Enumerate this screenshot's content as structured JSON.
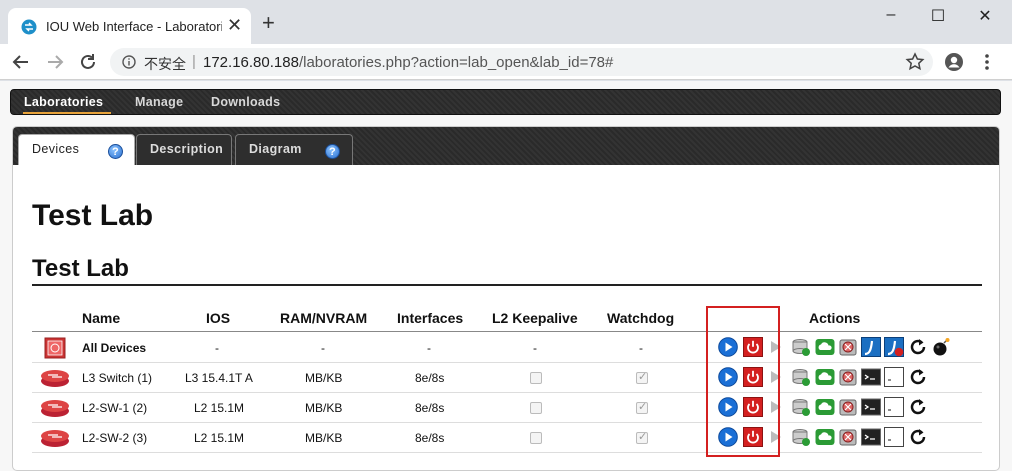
{
  "browser": {
    "tab_title": "IOU Web Interface - Laboratories",
    "new_tab": "+",
    "close_tab": "✕",
    "window_controls": {
      "minimize": "–",
      "maximize": "☐",
      "close": "✕"
    },
    "security_label": "不安全",
    "url_host": "172.16.80.188",
    "url_path": "/laboratories.php?action=lab_open&lab_id=78#"
  },
  "main_nav": [
    {
      "label": "Laboratories",
      "active": true
    },
    {
      "label": "Manage",
      "active": false
    },
    {
      "label": "Downloads",
      "active": false
    }
  ],
  "inner_tabs": [
    {
      "label": "Devices",
      "active": true,
      "help": true
    },
    {
      "label": "Description",
      "active": false,
      "help": false
    },
    {
      "label": "Diagram",
      "active": false,
      "help": true
    }
  ],
  "help_glyph": "?",
  "page_title": "Test Lab",
  "section_title": "Test Lab",
  "table": {
    "headers": {
      "name": "Name",
      "ios": "IOS",
      "ram": "RAM/NVRAM",
      "interfaces": "Interfaces",
      "l2keepalive": "L2 Keepalive",
      "watchdog": "Watchdog",
      "actions": "Actions"
    },
    "all_devices": {
      "name": "All Devices",
      "ios": "-",
      "ram": "-",
      "interfaces": "-",
      "l2keepalive": "-",
      "watchdog": "-"
    },
    "rows": [
      {
        "name": "L3 Switch (1)",
        "ios": "L3 15.4.1T A",
        "ram": "MB/KB",
        "interfaces": "8e/8s",
        "l2keepalive": false,
        "watchdog": true
      },
      {
        "name": "L2-SW-1 (2)",
        "ios": "L2 15.1M",
        "ram": "MB/KB",
        "interfaces": "8e/8s",
        "l2keepalive": false,
        "watchdog": true
      },
      {
        "name": "L2-SW-2 (3)",
        "ios": "L2 15.1M",
        "ram": "MB/KB",
        "interfaces": "8e/8s",
        "l2keepalive": false,
        "watchdog": true
      }
    ]
  },
  "colors": {
    "accent_underline": "#e8a33a",
    "highlight_box": "#d42020",
    "start_blue": "#1a6fd6",
    "stop_red": "#d42020"
  }
}
